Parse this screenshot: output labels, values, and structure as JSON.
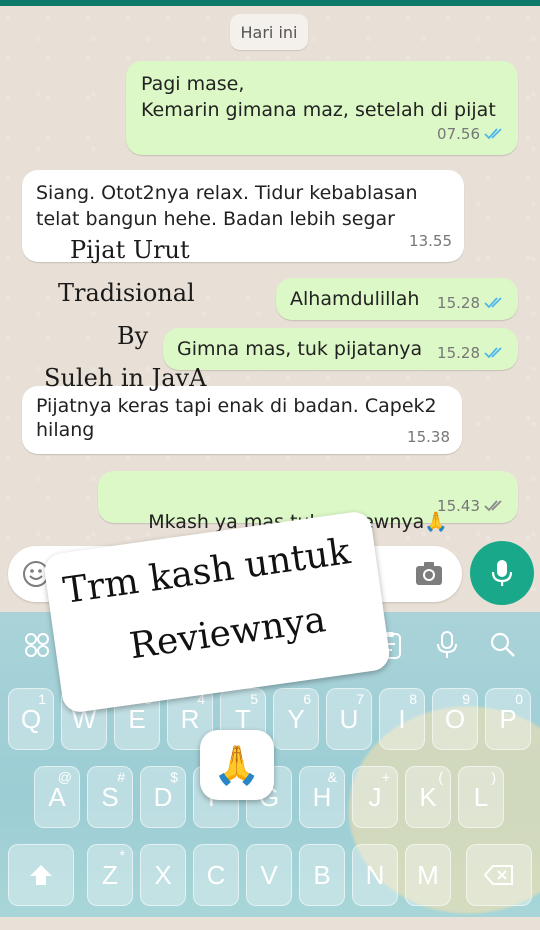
{
  "chat": {
    "date_label": "Hari ini",
    "messages": [
      {
        "dir": "out",
        "text": "Pagi mase,\nKemarin gimana maz, setelah di pijat",
        "time": "07.56",
        "status": "read"
      },
      {
        "dir": "in",
        "text": "Siang. Otot2nya relax. Tidur kebablasan\ntelat bangun hehe. Badan lebih segar",
        "time": "13.55"
      },
      {
        "dir": "out",
        "text": "Alhamdulillah",
        "time": "15.28",
        "status": "read"
      },
      {
        "dir": "out",
        "text": "Gimna mas, tuk pijatanya",
        "time": "15.28",
        "status": "read"
      },
      {
        "dir": "in",
        "text": "Pijatnya keras tapi enak di badan. Capek2\nhilang",
        "time": "15.38"
      },
      {
        "dir": "out",
        "text": "Mkash ya mas tuk reviewnya",
        "emoji": "🙏",
        "time": "15.43",
        "status": "sent"
      }
    ]
  },
  "overlay": {
    "line1": "Pijat Urut",
    "line2": "Tradisional",
    "line3": "By",
    "line4": "Suleh in JavA"
  },
  "sticker": {
    "line1": "Trm kash untuk",
    "line2": "Reviewnya",
    "emoji": "🙏"
  },
  "input": {
    "emoji_icon": "smiley-icon",
    "camera_icon": "camera-icon",
    "mic_icon": "mic-icon"
  },
  "keyboard": {
    "row1": [
      {
        "k": "Q",
        "s": "1"
      },
      {
        "k": "W",
        "s": "2"
      },
      {
        "k": "E",
        "s": "3"
      },
      {
        "k": "R",
        "s": "4"
      },
      {
        "k": "T",
        "s": "5"
      },
      {
        "k": "Y",
        "s": "6"
      },
      {
        "k": "U",
        "s": "7"
      },
      {
        "k": "I",
        "s": "8"
      },
      {
        "k": "O",
        "s": "9"
      },
      {
        "k": "P",
        "s": "0"
      }
    ],
    "row2": [
      {
        "k": "A",
        "s": "@"
      },
      {
        "k": "S",
        "s": "#"
      },
      {
        "k": "D",
        "s": "$"
      },
      {
        "k": "F",
        "s": ""
      },
      {
        "k": "G",
        "s": ""
      },
      {
        "k": "H",
        "s": "&"
      },
      {
        "k": "J",
        "s": "+"
      },
      {
        "k": "K",
        "s": "("
      },
      {
        "k": "L",
        "s": ")"
      }
    ],
    "row3": [
      {
        "k": "Z",
        "s": "*"
      },
      {
        "k": "X",
        "s": ""
      },
      {
        "k": "C",
        "s": ""
      },
      {
        "k": "V",
        "s": ""
      },
      {
        "k": "B",
        "s": ""
      },
      {
        "k": "N",
        "s": ""
      },
      {
        "k": "M",
        "s": ""
      }
    ],
    "colors": {
      "accent": "#1aa88b",
      "out_bubble": "#dcf8c6",
      "read_tick": "#4fb6ec"
    }
  }
}
